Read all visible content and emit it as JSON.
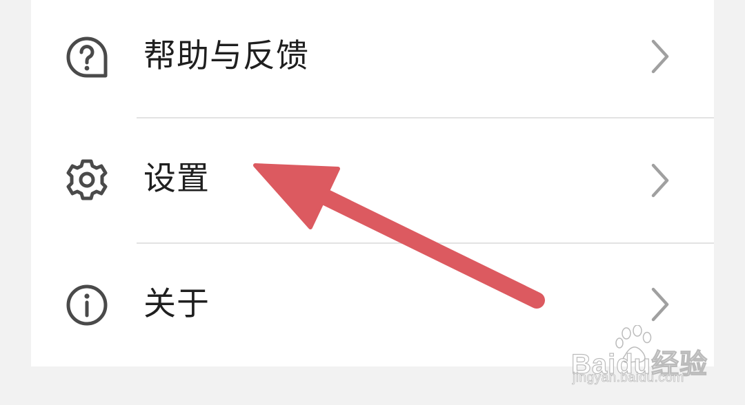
{
  "menu": {
    "items": [
      {
        "label": "帮助与反馈",
        "icon": "help-feedback-icon"
      },
      {
        "label": "设置",
        "icon": "gear-icon"
      },
      {
        "label": "关于",
        "icon": "info-icon"
      }
    ],
    "chevron_icon": "chevron-right-icon"
  },
  "annotation": {
    "arrow_color": "#dc5a60",
    "target": "设置"
  },
  "watermark": {
    "main": "Baidu经验",
    "sub": "jingyan.baidu.com"
  }
}
